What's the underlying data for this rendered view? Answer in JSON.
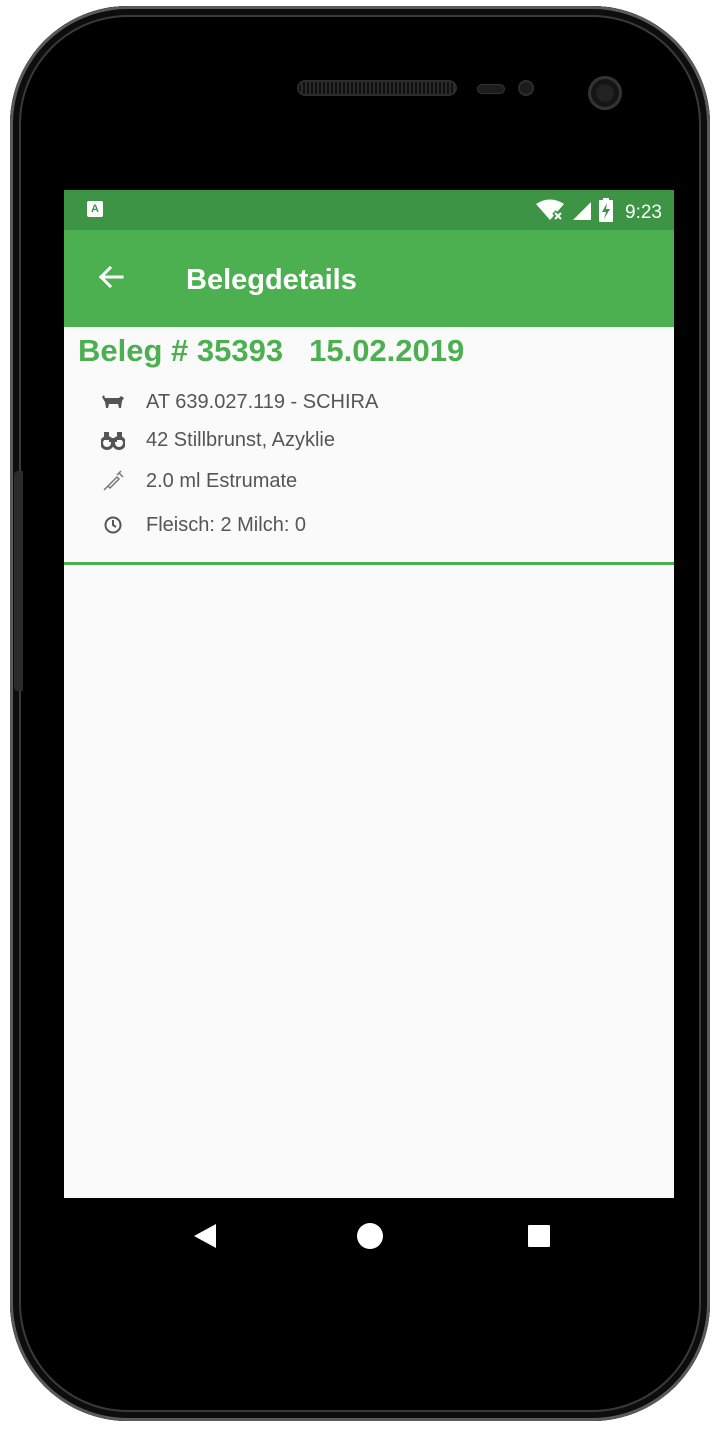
{
  "status_bar": {
    "notification_badge": "A",
    "time": "9:23",
    "icons": [
      "wifi-off-icon",
      "signal-icon",
      "battery-charging-icon"
    ]
  },
  "app_bar": {
    "title": "Belegdetails",
    "back_icon": "arrow-back-icon"
  },
  "receipt": {
    "number_label": "Beleg # 35393",
    "date": "15.02.2019",
    "details": [
      {
        "icon": "cow-icon",
        "text": "AT 639.027.119 - SCHIRA"
      },
      {
        "icon": "binoculars-icon",
        "text": "42 Stillbrunst, Azyklie"
      },
      {
        "icon": "syringe-icon",
        "text": "2.0 ml Estrumate"
      },
      {
        "icon": "clock-icon",
        "text": "Fleisch: 2  Milch: 0"
      }
    ]
  },
  "nav_bar": {
    "buttons": [
      "back-nav-icon",
      "home-nav-icon",
      "recents-nav-icon"
    ]
  },
  "colors": {
    "primary": "#4caf50",
    "primary_dark": "#3d9444",
    "text_secondary": "#555555",
    "background": "#fafafa"
  }
}
